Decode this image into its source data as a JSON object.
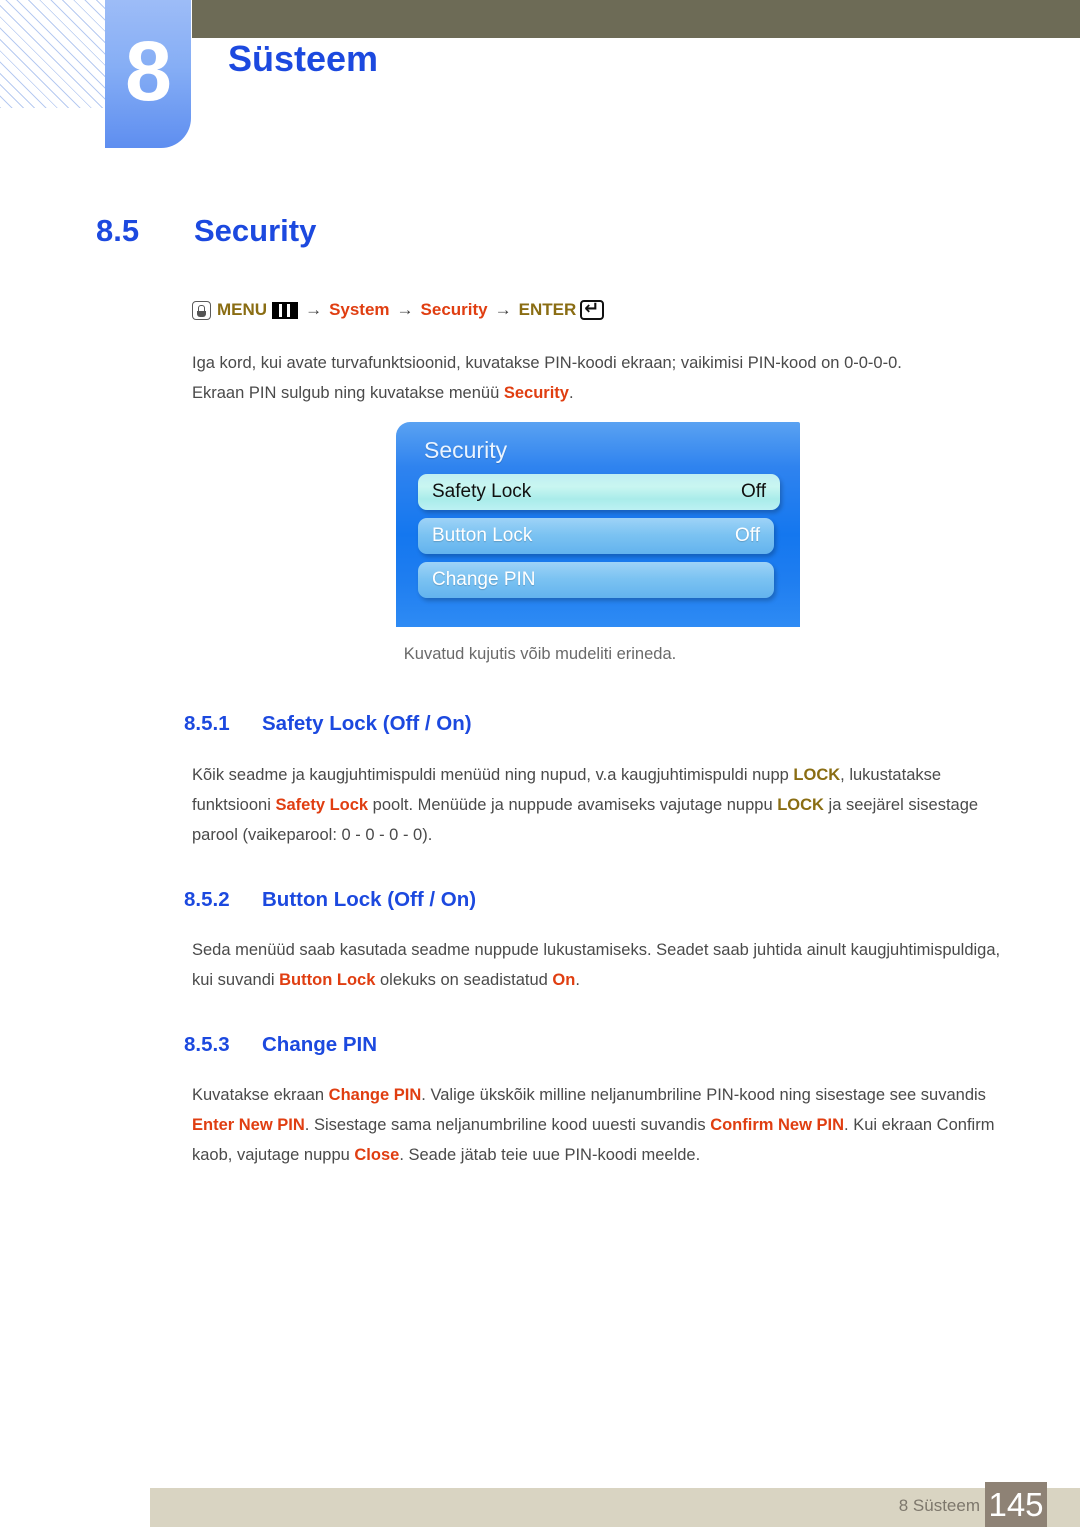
{
  "chapter": {
    "number": "8",
    "title": "Süsteem"
  },
  "section": {
    "number": "8.5",
    "title": "Security"
  },
  "menu_path": {
    "source_icon": "hand-press-icon",
    "menu_label": "MENU",
    "menu_icon": "menu-bars-icon",
    "arrow": "→",
    "item1": "System",
    "item2": "Security",
    "enter_label": "ENTER",
    "enter_icon": "enter-return-icon"
  },
  "intro": {
    "line1": "Iga kord, kui avate turvafunktsioonid, kuvatakse PIN-koodi ekraan; vaikimisi PIN-kood on 0-0-0-0.",
    "line2_a": "Ekraan PIN sulgub ning kuvatakse menüü ",
    "line2_hl": "Security",
    "line2_b": "."
  },
  "osd": {
    "title": "Security",
    "rows": [
      {
        "label": "Safety Lock",
        "value": "Off",
        "selected": true
      },
      {
        "label": "Button Lock",
        "value": "Off",
        "selected": false
      },
      {
        "label": "Change PIN",
        "value": "",
        "selected": false
      }
    ]
  },
  "osd_caption": "Kuvatud kujutis võib mudeliti erineda.",
  "subsections": [
    {
      "number": "8.5.1",
      "title": "Safety Lock (Off / On)",
      "paragraph": {
        "p1": "Kõik seadme ja kaugjuhtimispuldi menüüd ning nupud, v.a kaugjuhtimispuldi nupp ",
        "b1": "LOCK",
        "p2": ", lukustatakse funktsiooni ",
        "r1": "Safety Lock",
        "p3": " poolt. Menüüde ja nuppude avamiseks vajutage nuppu ",
        "b2": "LOCK",
        "p4": " ja seejärel sisestage parool (vaikeparool: 0 - 0 - 0 - 0)."
      }
    },
    {
      "number": "8.5.2",
      "title": "Button Lock (Off / On)",
      "paragraph": {
        "p1": "Seda menüüd saab kasutada seadme nuppude lukustamiseks. Seadet saab juhtida ainult kaugjuhtimispuldiga, kui suvandi ",
        "r1": "Button Lock",
        "p2": " olekuks on seadistatud ",
        "r2": "On",
        "p3": "."
      }
    },
    {
      "number": "8.5.3",
      "title": "Change PIN",
      "paragraph": {
        "p1": "Kuvatakse ekraan ",
        "r1": "Change PIN",
        "p2": ". Valige ükskõik milline neljanumbriline PIN-kood ning sisestage see suvandis ",
        "r2": "Enter New PIN",
        "p3": ". Sisestage sama neljanumbriline kood uuesti suvandis ",
        "r3": "Confirm New PIN",
        "p4": ". Kui ekraan Confirm kaob, vajutage nuppu ",
        "r4": "Close",
        "p5": ". Seade jätab teie uue PIN-koodi meelde."
      }
    }
  ],
  "footer": {
    "label": "8 Süsteem",
    "page": "145"
  },
  "colors": {
    "heading_blue": "#1c49df",
    "highlight_red": "#e03e11",
    "button_olive": "#8a6d13",
    "olive_bar": "#6d6b56",
    "footer_bar": "#d9d4c2",
    "page_box": "#8e8275"
  }
}
